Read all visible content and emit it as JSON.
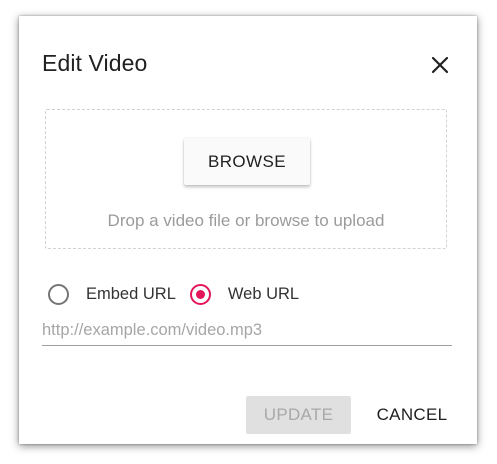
{
  "dialog": {
    "title": "Edit Video",
    "close_icon": "close-icon"
  },
  "dropzone": {
    "browse_label": "BROWSE",
    "hint": "Drop a video file or browse to upload"
  },
  "source_options": {
    "selected": "Web URL",
    "items": [
      {
        "label": "Embed URL",
        "checked": false
      },
      {
        "label": "Web URL",
        "checked": true
      }
    ]
  },
  "url_field": {
    "value": "",
    "placeholder": "http://example.com/video.mp3"
  },
  "footer": {
    "update_label": "UPDATE",
    "update_disabled": true,
    "cancel_label": "CANCEL"
  },
  "colors": {
    "accent": "#e3165b",
    "text": "#212121",
    "muted": "#9b9b9b",
    "disabled_bg": "#e0e0e0"
  }
}
